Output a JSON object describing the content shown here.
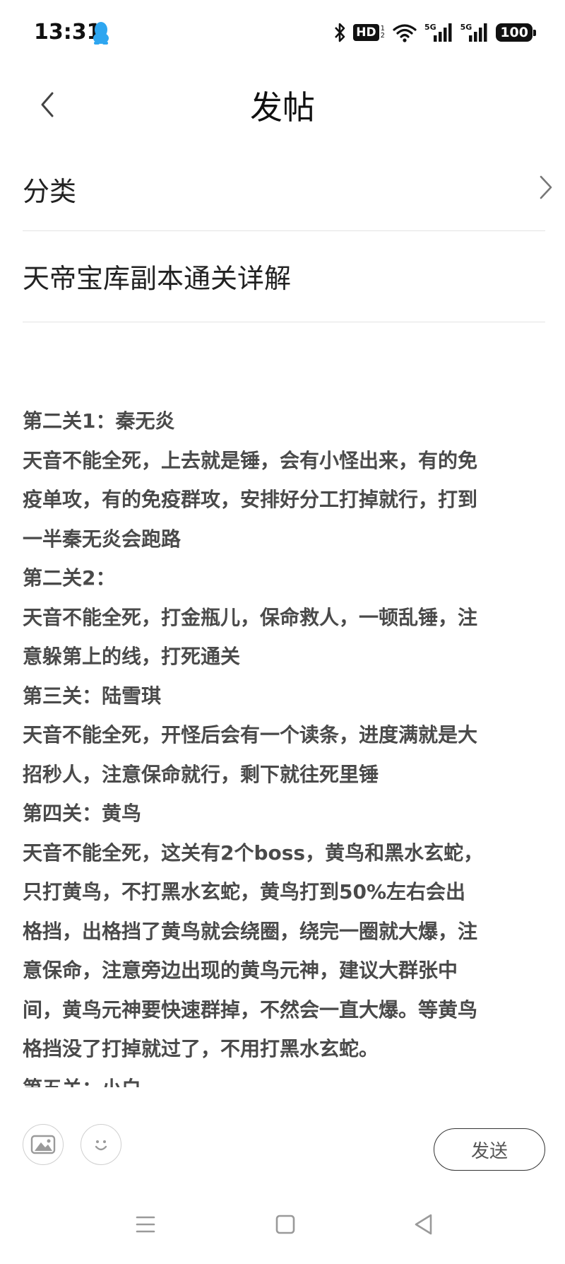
{
  "status_bar": {
    "time": "13:31",
    "icons": [
      "qq-icon",
      "bluetooth-icon",
      "hd-icon",
      "wifi-icon",
      "signal-5g-icon",
      "signal-5g-icon",
      "battery-icon"
    ],
    "hd_label": "HD",
    "hd_sub_top": "1",
    "hd_sub_bottom": "2",
    "network_label": "5G",
    "battery": "100",
    "qq_color": "#2ea6f0"
  },
  "header": {
    "title": "发帖"
  },
  "category": {
    "label": "分类"
  },
  "post": {
    "title": "天帝宝库副本通关详解",
    "body_lines": [
      "第二关1：秦无炎",
      "天音不能全死，上去就是锤，会有小怪出来，有的免",
      "疫单攻，有的免疫群攻，安排好分工打掉就行，打到",
      "一半秦无炎会跑路",
      "第二关2：",
      "天音不能全死，打金瓶儿，保命救人，一顿乱锤，注",
      "意躲第上的线，打死通关",
      "第三关：陆雪琪",
      "天音不能全死，开怪后会有一个读条，进度满就是大",
      "招秒人，注意保命就行，剩下就往死里锤",
      "第四关：黄鸟",
      "天音不能全死，这关有2个boss，黄鸟和黑水玄蛇，",
      "只打黄鸟，不打黑水玄蛇，黄鸟打到50%左右会出",
      "格挡，出格挡了黄鸟就会绕圈，绕完一圈就大爆，注",
      "意保命，注意旁边出现的黄鸟元神，建议大群张中",
      "间，黄鸟元神要快速群掉，不然会一直大爆。等黄鸟",
      "格挡没了打掉就过了，不用打黑水玄蛇。",
      "第五关：小白"
    ]
  },
  "toolbar": {
    "send_label": "发送"
  },
  "colors": {
    "body_text": "#4a4a4a",
    "divider": "#e3e3e3"
  }
}
